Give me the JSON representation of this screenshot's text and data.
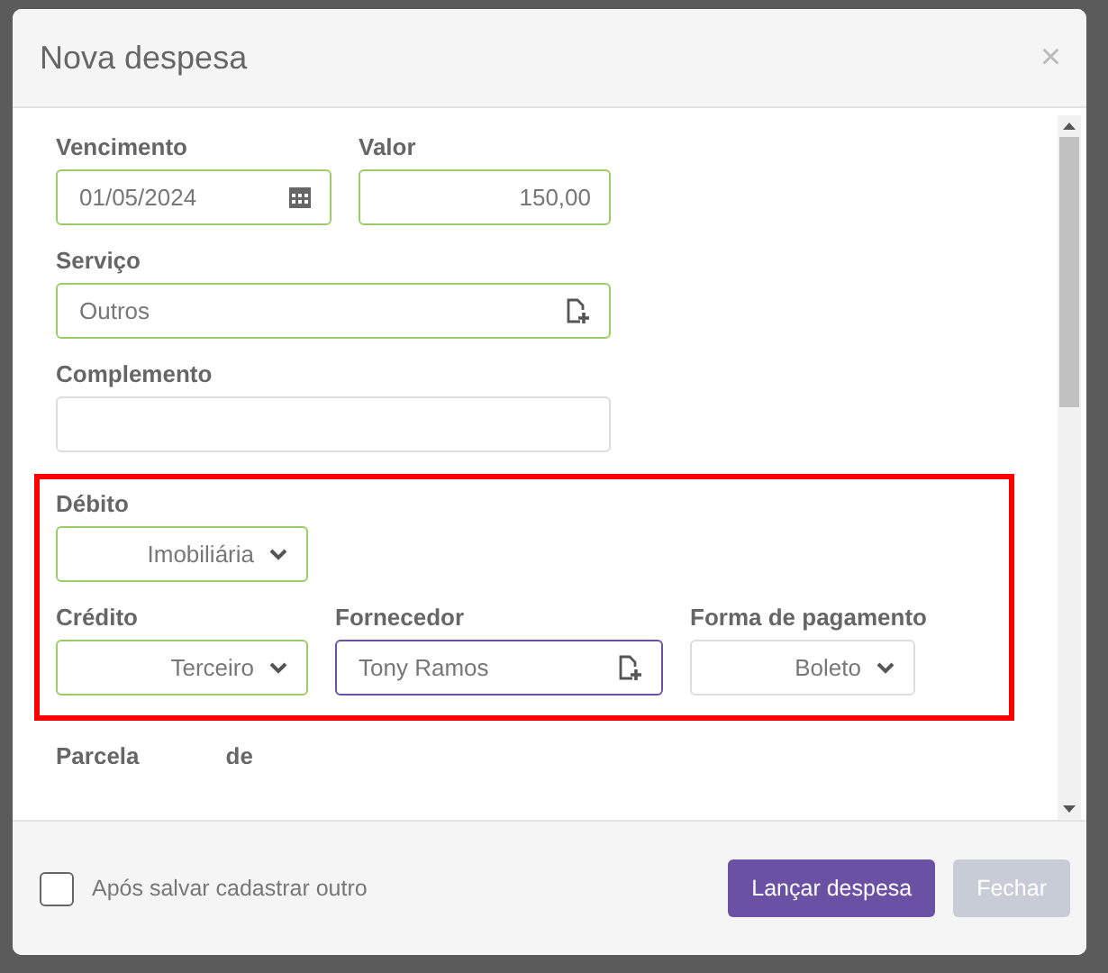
{
  "dialog": {
    "title": "Nova despesa",
    "close": "×"
  },
  "sections": [
    {
      "highlighted": false,
      "rows": [
        [
          {
            "label": "Vencimento",
            "kind": "date",
            "value": "01/05/2024",
            "valid": true,
            "focused": false
          },
          {
            "label": "Valor",
            "kind": "number",
            "value": "150,00",
            "valid": true,
            "focused": false
          }
        ],
        [
          {
            "label": "Serviço",
            "kind": "lookup",
            "value": "Outros",
            "valid": true,
            "focused": false
          }
        ],
        [
          {
            "label": "Complemento",
            "kind": "text",
            "valid": false,
            "focused": false
          }
        ]
      ]
    },
    {
      "highlighted": true,
      "rows": [
        [
          {
            "label": "Débito",
            "kind": "select",
            "value": "Imobiliária",
            "valid": true,
            "focused": false
          }
        ],
        [
          {
            "label": "Crédito",
            "kind": "select",
            "value": "Terceiro",
            "valid": true,
            "focused": false
          },
          {
            "label": "Fornecedor",
            "kind": "lookup",
            "value": "Tony Ramos",
            "valid": false,
            "focused": true
          },
          {
            "label": "Forma de pagamento",
            "kind": "select",
            "value": "Boleto",
            "valid": false,
            "focused": false
          }
        ]
      ]
    }
  ],
  "partial_labels": [
    "Parcela",
    "de"
  ],
  "footer": {
    "checkbox": {
      "label": "Após salvar cadastrar outro",
      "checked": false
    },
    "buttons": [
      {
        "label": "Lançar despesa",
        "disabled": false
      },
      {
        "label": "Fechar",
        "disabled": true
      }
    ]
  }
}
